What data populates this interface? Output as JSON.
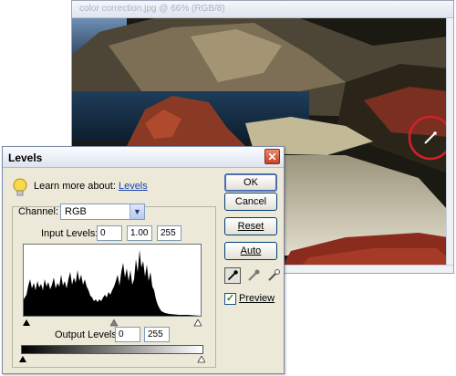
{
  "image_window": {
    "title": "color correction.jpg @ 66% (RGB/8)"
  },
  "dialog": {
    "title": "Levels",
    "close": "✕",
    "learn_prefix": "Learn more about:",
    "learn_link": "Levels",
    "channel_label": "Channel:",
    "channel_value": "RGB",
    "input_levels_label": "Input Levels:",
    "input_levels": [
      "0",
      "1.00",
      "255"
    ],
    "output_levels_label": "Output Levels:",
    "output_levels": [
      "0",
      "255"
    ],
    "buttons": {
      "ok": "OK",
      "cancel": "Cancel",
      "reset": "Reset",
      "auto": "Auto"
    },
    "preview_label": "Preview",
    "preview_checked": "✓"
  }
}
